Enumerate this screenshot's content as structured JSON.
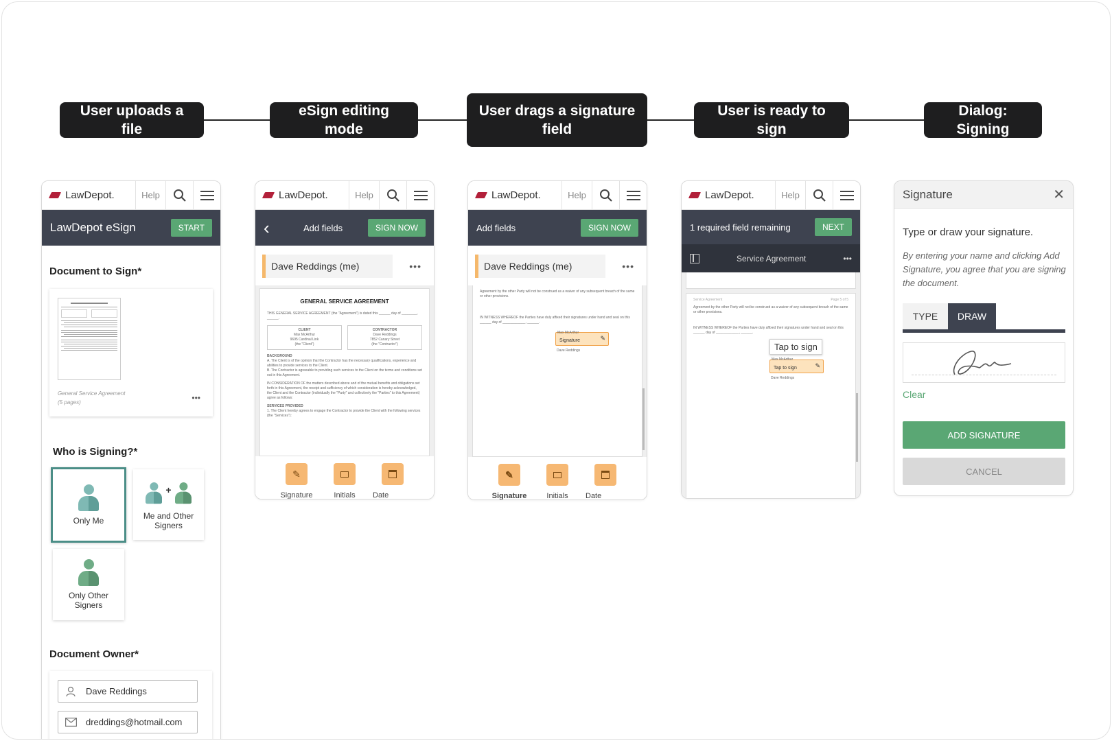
{
  "steps": [
    "User uploads a file",
    "eSign editing mode",
    "User drags a signature field",
    "User is ready to sign",
    "Dialog: Signing"
  ],
  "common": {
    "logo": "LawDepot.",
    "help": "Help"
  },
  "screen1": {
    "header_title": "LawDepot eSign",
    "start_button": "START",
    "doc_label": "Document to Sign*",
    "doc_name": "General Service Agreement",
    "doc_pages": "(5 pages)",
    "doc_menu": "•••",
    "who_label": "Who is Signing?*",
    "options": [
      "Only Me",
      "Me and Other Signers",
      "Only Other Signers"
    ],
    "owner_label": "Document Owner*",
    "owner_name": "Dave Reddings",
    "owner_email": "dreddings@hotmail.com"
  },
  "screen2": {
    "back": "‹",
    "header": "Add fields",
    "sign_now": "SIGN NOW",
    "signer": "Dave Reddings (me)",
    "more": "•••",
    "doc_title": "GENERAL SERVICE AGREEMENT",
    "doc_intro": "THIS GENERAL SERVICE AGREEMENT (the \"Agreement\") is dated this ______ day of ________, ______.",
    "client_label": "CLIENT",
    "client_lines": [
      "Max McArthur",
      "9695 Cardinal Link",
      "(the \"Client\")"
    ],
    "contractor_label": "CONTRACTOR",
    "contractor_lines": [
      "Dave Reddings",
      "7852 Canary Street",
      "(the \"Contractor\")"
    ],
    "background_label": "BACKGROUND",
    "background_a": "A. The Client is of the opinion that the Contractor has the necessary qualifications, experience and abilities to provide services to the Client.",
    "background_b": "B. The Contractor is agreeable to providing such services to the Client on the terms and conditions set out in this Agreement.",
    "consideration": "IN CONSIDERATION OF the matters described above and of the mutual benefits and obligations set forth in this Agreement, the receipt and sufficiency of which consideration is hereby acknowledged, the Client and the Contractor (individually the \"Party\" and collectively the \"Parties\" to this Agreement) agree as follows:",
    "services_label": "SERVICES PROVIDED",
    "services_1": "1. The Client hereby agrees to engage the Contractor to provide the Client with the following services (the \"Services\"):",
    "tools": [
      "Signature",
      "Initials",
      "Date Signed"
    ]
  },
  "screen3": {
    "header": "Add fields",
    "sign_now": "SIGN NOW",
    "signer": "Dave Reddings (me)",
    "more": "•••",
    "waiver": "Agreement by the other Party will not be construed as a waiver of any subsequent breach of the same or other provisions.",
    "witness": "IN WITNESS WHEREOF the Parties have duly affixed their signatures under hand and seal on this ______ day of ____________, ______.",
    "sig_small": "Max McArthur",
    "sig_field": "Signature",
    "signer_below": "Dave Reddings",
    "tools": [
      "Signature",
      "Initials",
      "Date Signed"
    ]
  },
  "screen4": {
    "header": "1 required field remaining",
    "next": "NEXT",
    "doc_title": "Service Agreement",
    "more": "•••",
    "page_header_left": "Service Agreement",
    "page_header_right": "Page 5 of 5",
    "waiver": "Agreement by the other Party will not be construed as a waiver of any subsequent breach of the same or other provisions.",
    "witness": "IN WITNESS WHEREOF the Parties have duly affixed their signatures under hand and seal on this ______ day of ____________, ______.",
    "tooltip": "Tap to sign",
    "sig_small": "Max McArthur",
    "tap_field": "Tap to sign",
    "signer_below": "Dave Reddings"
  },
  "dialog": {
    "title": "Signature",
    "close": "✕",
    "instruction": "Type or draw your signature.",
    "legal": "By entering your name and clicking Add Signature, you agree that you are signing the document.",
    "tab_type": "TYPE",
    "tab_draw": "DRAW",
    "clear": "Clear",
    "add": "ADD SIGNATURE",
    "cancel": "CANCEL"
  },
  "colors": {
    "dark": "#1e1e1f",
    "bar": "#3e4350",
    "green": "#5aa774",
    "orange": "#f6b873",
    "brand": "#b2203a",
    "teal": "#4b8e87"
  }
}
